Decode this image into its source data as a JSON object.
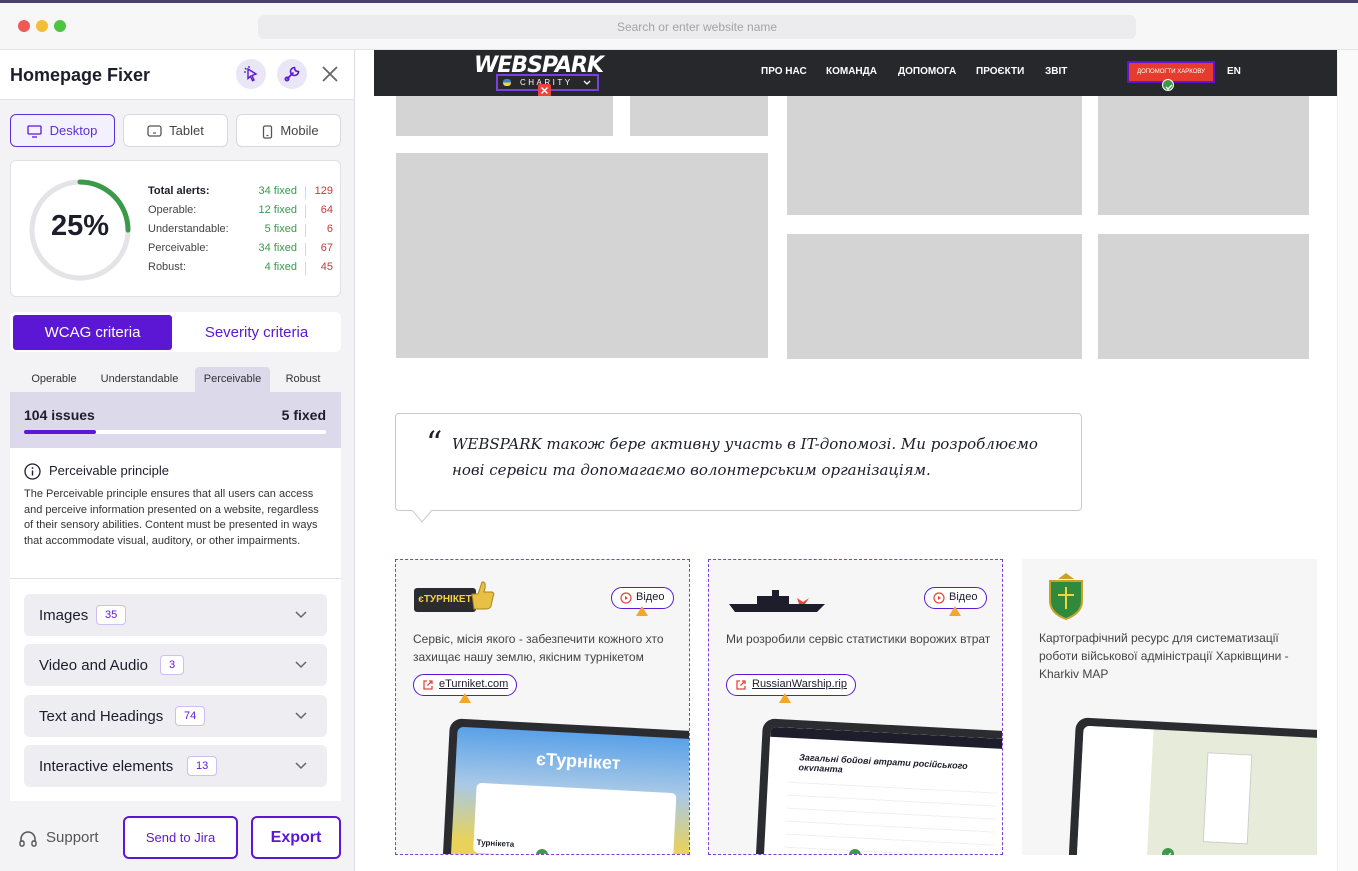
{
  "browser": {
    "url_placeholder": "Search or enter website name"
  },
  "panel": {
    "title": "Homepage Fixer",
    "devices": [
      {
        "label": "Desktop"
      },
      {
        "label": "Tablet"
      },
      {
        "label": "Mobile"
      }
    ],
    "score": {
      "percent": "25%",
      "progress": 0.25
    },
    "stats": [
      {
        "label": "Total alerts:",
        "fixed": "34 fixed",
        "total": "129"
      },
      {
        "label": "Operable:",
        "fixed": "12 fixed",
        "total": "64"
      },
      {
        "label": "Understandable:",
        "fixed": "5 fixed",
        "total": "6"
      },
      {
        "label": "Perceivable:",
        "fixed": "34 fixed",
        "total": "67"
      },
      {
        "label": "Robust:",
        "fixed": "4 fixed",
        "total": "45"
      }
    ],
    "criteria": {
      "wcag": "WCAG criteria",
      "severity": "Severity criteria"
    },
    "principle_tabs": [
      {
        "label": "Operable"
      },
      {
        "label": "Understandable"
      },
      {
        "label": "Perceivable"
      },
      {
        "label": "Robust"
      }
    ],
    "issues": {
      "count": "104 issues",
      "fixed": "5 fixed",
      "progress": 0.24
    },
    "principle": {
      "title": "Perceivable principle",
      "description": "The Perceivable principle ensures that all users can access and perceive information presented on a website, regardless of their sensory abilities. Content must be presented in ways that accommodate visual, auditory, or other impairments."
    },
    "categories": [
      {
        "label": "Images",
        "count": "35"
      },
      {
        "label": "Video and Audio",
        "count": "3"
      },
      {
        "label": "Text and Headings",
        "count": "74"
      },
      {
        "label": "Interactive elements",
        "count": "13"
      }
    ],
    "footer": {
      "support": "Support",
      "jira": "Send to Jira",
      "export": "Export"
    }
  },
  "site": {
    "logo": "WEBSPARK",
    "charity": "CHARITY",
    "nav": [
      "ПРО НАС",
      "КОМАНДА",
      "ДОПОМОГА",
      "ПРОЄКТИ",
      "ЗВІТ"
    ],
    "donate": "ДОПОМОГТИ ХАРКОВУ",
    "lang": "EN",
    "quote": "WEBSPARK також бере активну участь в IT-допомозі. Ми розроблюємо нові сервіси та допомагаємо волонтерським організаціям.",
    "cards": [
      {
        "desc": "Сервіс, місія якого - забезпечити кожного хто захищає нашу землю, якісним турнікетом",
        "video": "Відео",
        "link": "eTurniket.com",
        "logo_text": "єТУРНІКЕТ",
        "screen_title": "єТурнікет",
        "screen_footer": "Турнікета"
      },
      {
        "desc": "Ми розробили сервіс статистики ворожих втрат",
        "video": "Відео",
        "link": "RussianWarship.rip",
        "screen_title": "Загальні бойові втрати російського окупанта"
      },
      {
        "desc": "Картографічний ресурс для систематизації роботи військової адміністрації Харківщини - Kharkiv MAP"
      }
    ],
    "colors": {
      "accent": "#5b17d3",
      "fixed": "#3a9a4a",
      "alert": "#c93838",
      "warning": "#f5a623"
    }
  }
}
